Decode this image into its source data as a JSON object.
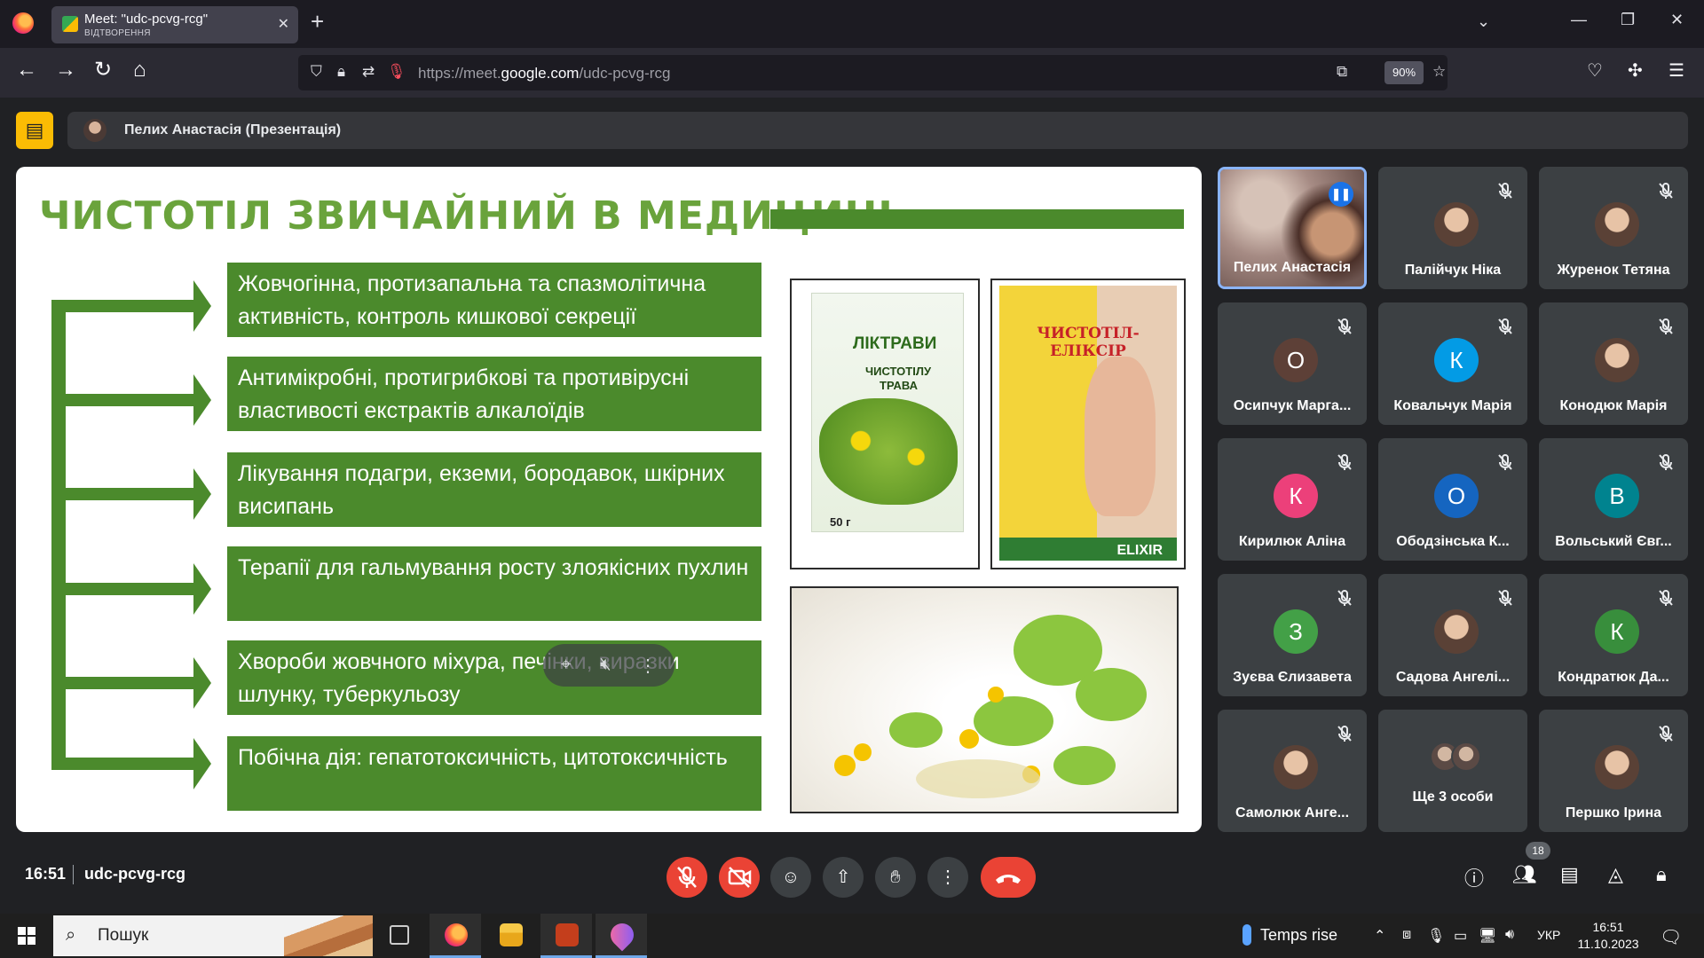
{
  "browser": {
    "tab_title": "Meet: \"udc-pcvg-rcg\"",
    "tab_subtitle": "ВІДТВОРЕННЯ",
    "url_prefix": "https://meet.",
    "url_host": "google.com",
    "url_path": "/udc-pcvg-rcg",
    "zoom": "90%"
  },
  "meet": {
    "presenter_label": "Пелих Анастасія (Презентація)",
    "time": "16:51",
    "meeting_code": "udc-pcvg-rcg",
    "participants_count": "18"
  },
  "slide": {
    "title": "ЧИСТОТІЛ ЗВИЧАЙНИЙ В МЕДИЦИНІ",
    "facts": [
      "Жовчогінна, протизапальна та спазмолітична активність, контроль кишкової секреції",
      "Антимікробні, протигрибкові та противірусні властивості екстрактів алкалоїдів",
      "Лікування подагри, екземи, бородавок, шкірних висипань",
      "Терапії для гальмування росту злоякісних пухлин",
      "Хвороби жовчного міхура, печінки, виразки шлунку, туберкульозу",
      "Побічна дія: гепатотоксичність, цитотоксичність"
    ],
    "product1": {
      "brand": "ЛІКТРАВИ",
      "line1": "ЧИСТОТІЛУ",
      "line2": "ТРАВА",
      "weight": "50 г"
    },
    "product2": {
      "name": "ЧИСТОТІЛ-ЕЛІКСІР",
      "brand": "ELIXIR"
    }
  },
  "participants": [
    {
      "name": "Пелих Анастасія",
      "kind": "video",
      "speaking": true
    },
    {
      "name": "Палійчук Ніка",
      "kind": "photo",
      "muted": true
    },
    {
      "name": "Журенок Тетяна",
      "kind": "photo",
      "muted": true
    },
    {
      "name": "Осипчук Марга...",
      "kind": "letter",
      "letter": "О",
      "color": "#5d4037",
      "muted": true
    },
    {
      "name": "Ковальчук Марія",
      "kind": "letter",
      "letter": "К",
      "color": "#039be5",
      "muted": true
    },
    {
      "name": "Конодюк Марія",
      "kind": "photo",
      "muted": true
    },
    {
      "name": "Кирилюк Аліна",
      "kind": "letter",
      "letter": "К",
      "color": "#ec407a",
      "muted": true
    },
    {
      "name": "Ободзінська К...",
      "kind": "letter",
      "letter": "О",
      "color": "#1565c0",
      "muted": true
    },
    {
      "name": "Вольський Євг...",
      "kind": "letter",
      "letter": "В",
      "color": "#00838f",
      "muted": true
    },
    {
      "name": "Зуєва Єлизавета",
      "kind": "letter",
      "letter": "З",
      "color": "#43a047",
      "muted": true
    },
    {
      "name": "Садова Ангелі...",
      "kind": "photo",
      "muted": true
    },
    {
      "name": "Кондратюк Да...",
      "kind": "letter",
      "letter": "К",
      "color": "#388e3c",
      "muted": true
    },
    {
      "name": "Самолюк Анге...",
      "kind": "photo",
      "muted": true
    },
    {
      "name": "Ще 3 особи",
      "kind": "more"
    },
    {
      "name": "Першко Ірина",
      "kind": "photo",
      "muted": true
    }
  ],
  "taskbar": {
    "search_placeholder": "Пошук",
    "weather": "Temps rise",
    "lang": "УКР",
    "time": "16:51",
    "date": "11.10.2023"
  },
  "icons": {
    "mute": "mic-off-icon",
    "camera": "camera-off-icon",
    "hangup": "call-end-icon"
  },
  "colors": {
    "slide_green": "#4b8a2c",
    "title_green": "#6aa33c",
    "meet_red": "#ea4335",
    "active_border": "#8ab4f8"
  }
}
